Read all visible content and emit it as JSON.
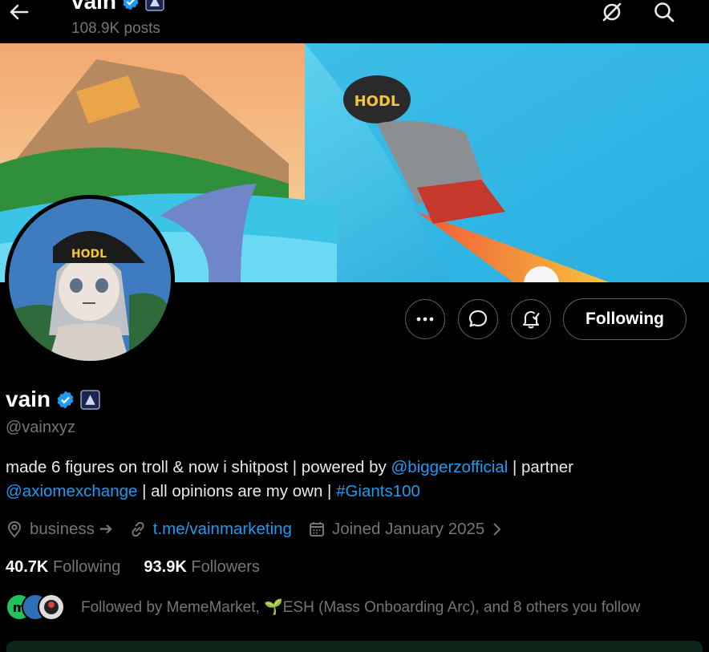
{
  "header": {
    "name": "vain",
    "posts": "108.9K posts"
  },
  "profile": {
    "name": "vain",
    "handle": "@vainxyz",
    "banner_text": "HODL",
    "avatar_text": "HODL",
    "bio": {
      "p1": "made 6 figures on troll & now i shitpost | powered by ",
      "link1": "@biggerzofficial",
      "p2": " | partner",
      "link2": "@axiomexchange",
      "p3": " | all opinions are my own | ",
      "link3": "#Giants100"
    },
    "location": "business ➔",
    "website": "t.me/vainmarketing",
    "joined": "Joined January 2025",
    "following_count": "40.7K",
    "following_label": "Following",
    "followers_count": "93.9K",
    "followers_label": "Followers",
    "followed_by_text": "Followed by MemeMarket, 🌱ESH (Mass Onboarding Arc), and 8 others you follow"
  },
  "actions": {
    "following_button": "Following"
  },
  "colors": {
    "background": "#000000",
    "accent": "#1d9bf0",
    "muted": "#71767b",
    "text": "#e7e9ea",
    "border": "#536471",
    "verified": "#1d9bf0"
  },
  "icons": [
    "back-arrow-icon",
    "grok-icon",
    "search-icon",
    "verified-badge-icon",
    "affiliate-badge-icon",
    "more-icon",
    "message-icon",
    "notification-bell-icon",
    "location-icon",
    "link-icon",
    "calendar-icon",
    "chevron-right-icon"
  ]
}
